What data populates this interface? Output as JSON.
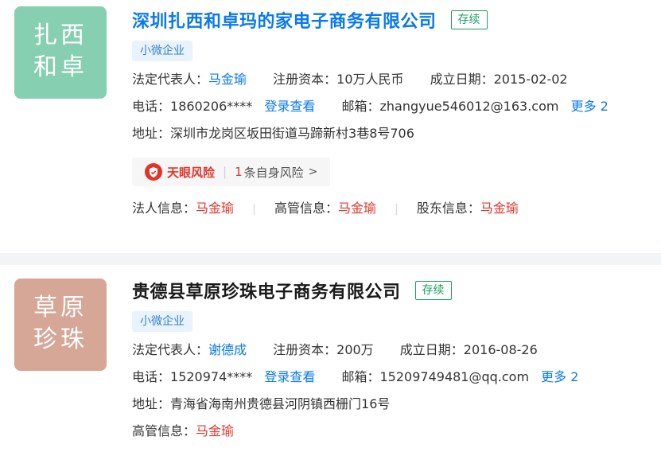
{
  "results": [
    {
      "logo_text": [
        "扎西",
        "和卓"
      ],
      "logo_color": "#86cfb0",
      "name": "深圳扎西和卓玛的家电子商务有限公司",
      "status": "存续",
      "tag": "小微企业",
      "legal_rep_label": "法定代表人：",
      "legal_rep": "马金瑜",
      "capital_label": "注册资本：",
      "capital": "10万人民币",
      "date_label": "成立日期：",
      "date": "2015-02-02",
      "phone_label": "电话：",
      "phone": "1860206****",
      "login_view": "登录查看",
      "email_label": "邮箱：",
      "email": "zhangyue546012@163.com",
      "more": "更多 2",
      "address_label": "地址：",
      "address": "深圳市龙岗区坂田街道马蹄新村3巷8号706",
      "risk": {
        "title": "天眼风险",
        "count": "1",
        "text": "条自身风险",
        "chevron": ">"
      },
      "persons": [
        {
          "label": "法人信息：",
          "value": "马金瑜"
        },
        {
          "label": "高管信息：",
          "value": "马金瑜"
        },
        {
          "label": "股东信息：",
          "value": "马金瑜"
        }
      ]
    },
    {
      "logo_text": [
        "草原",
        "珍珠"
      ],
      "logo_color": "#d6a696",
      "name": "贵德县草原珍珠电子商务有限公司",
      "status": "存续",
      "tag": "小微企业",
      "legal_rep_label": "法定代表人：",
      "legal_rep": "谢德成",
      "capital_label": "注册资本：",
      "capital": "200万",
      "date_label": "成立日期：",
      "date": "2016-08-26",
      "phone_label": "电话：",
      "phone": "1520974****",
      "login_view": "登录查看",
      "email_label": "邮箱：",
      "email": "15209749481@qq.com",
      "more": "更多 2",
      "address_label": "地址：",
      "address": "青海省海南州贵德县河阴镇西栅门16号",
      "persons": [
        {
          "label": "高管信息：",
          "value": "马金瑜"
        }
      ]
    }
  ]
}
